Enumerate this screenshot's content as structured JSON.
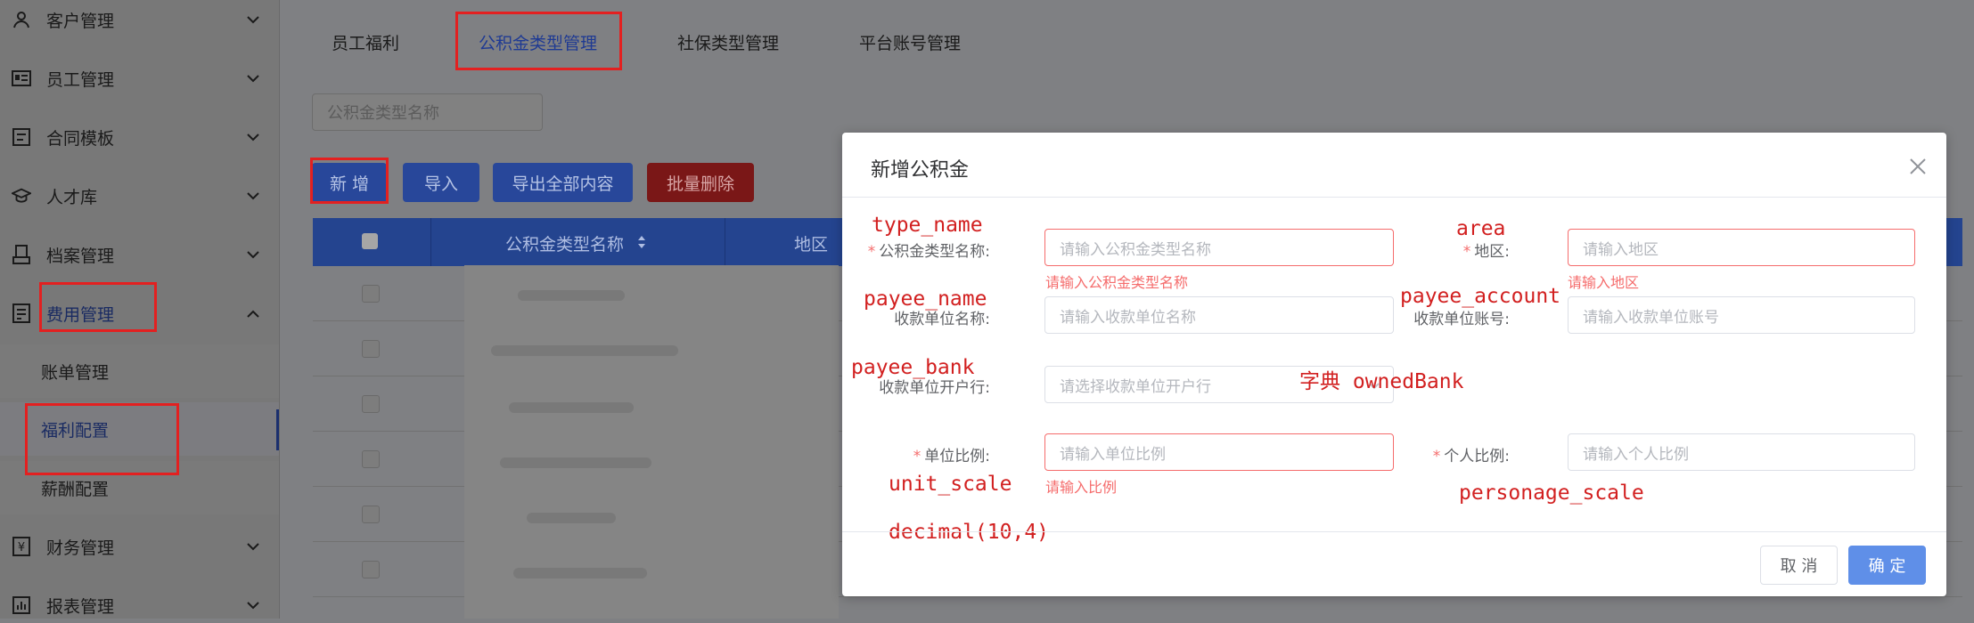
{
  "sidebar": {
    "items": [
      {
        "label": "客户管理",
        "icon": "user-icon",
        "expanded": false
      },
      {
        "label": "员工管理",
        "icon": "id-card-icon",
        "expanded": false
      },
      {
        "label": "合同模板",
        "icon": "template-icon",
        "expanded": false
      },
      {
        "label": "人才库",
        "icon": "graduation-cap-icon",
        "expanded": false
      },
      {
        "label": "档案管理",
        "icon": "archive-icon",
        "expanded": false
      },
      {
        "label": "费用管理",
        "icon": "expense-icon",
        "expanded": true
      },
      {
        "label": "财务管理",
        "icon": "finance-icon",
        "expanded": false
      },
      {
        "label": "报表管理",
        "icon": "chart-icon",
        "expanded": false
      }
    ],
    "subitems": [
      {
        "label": "账单管理",
        "active": false
      },
      {
        "label": "福利配置",
        "active": true
      },
      {
        "label": "薪酬配置",
        "active": false
      }
    ]
  },
  "tabs": [
    {
      "label": "员工福利",
      "active": false
    },
    {
      "label": "公积金类型管理",
      "active": true
    },
    {
      "label": "社保类型管理",
      "active": false
    },
    {
      "label": "平台账号管理",
      "active": false
    }
  ],
  "search": {
    "placeholder": "公积金类型名称"
  },
  "toolbar": {
    "add": "新 增",
    "import": "导入",
    "export_all": "导出全部内容",
    "batch_delete": "批量删除"
  },
  "table": {
    "columns": [
      "公积金类型名称",
      "地区"
    ]
  },
  "modal": {
    "title": "新增公积金",
    "fields": {
      "type_name": {
        "label": "公积金类型名称:",
        "placeholder": "请输入公积金类型名称",
        "error": "请输入公积金类型名称",
        "required": true
      },
      "area": {
        "label": "地区:",
        "placeholder": "请输入地区",
        "error": "请输入地区",
        "required": true
      },
      "payee_name": {
        "label": "收款单位名称:",
        "placeholder": "请输入收款单位名称",
        "required": false
      },
      "payee_account": {
        "label": "收款单位账号:",
        "placeholder": "请输入收款单位账号",
        "required": false
      },
      "payee_bank": {
        "label": "收款单位开户行:",
        "placeholder": "请选择收款单位开户行",
        "required": false
      },
      "unit_scale": {
        "label": "单位比例:",
        "placeholder": "请输入单位比例",
        "error": "请输入比例",
        "required": true
      },
      "personage_scale": {
        "label": "个人比例:",
        "placeholder": "请输入个人比例",
        "required": true
      }
    },
    "cancel": "取 消",
    "confirm": "确 定"
  },
  "annotations": {
    "type_name": "type_name",
    "area": "area",
    "payee_name": "payee_name",
    "payee_account": "payee_account",
    "payee_bank": "payee_bank",
    "owned_bank": "字典 ownedBank",
    "unit_scale": "unit_scale",
    "decimal": "decimal(10,4)",
    "personage_scale": "personage_scale"
  },
  "colors": {
    "primary": "#409eff",
    "danger": "#f56c6c",
    "annotation": "#e32020"
  }
}
